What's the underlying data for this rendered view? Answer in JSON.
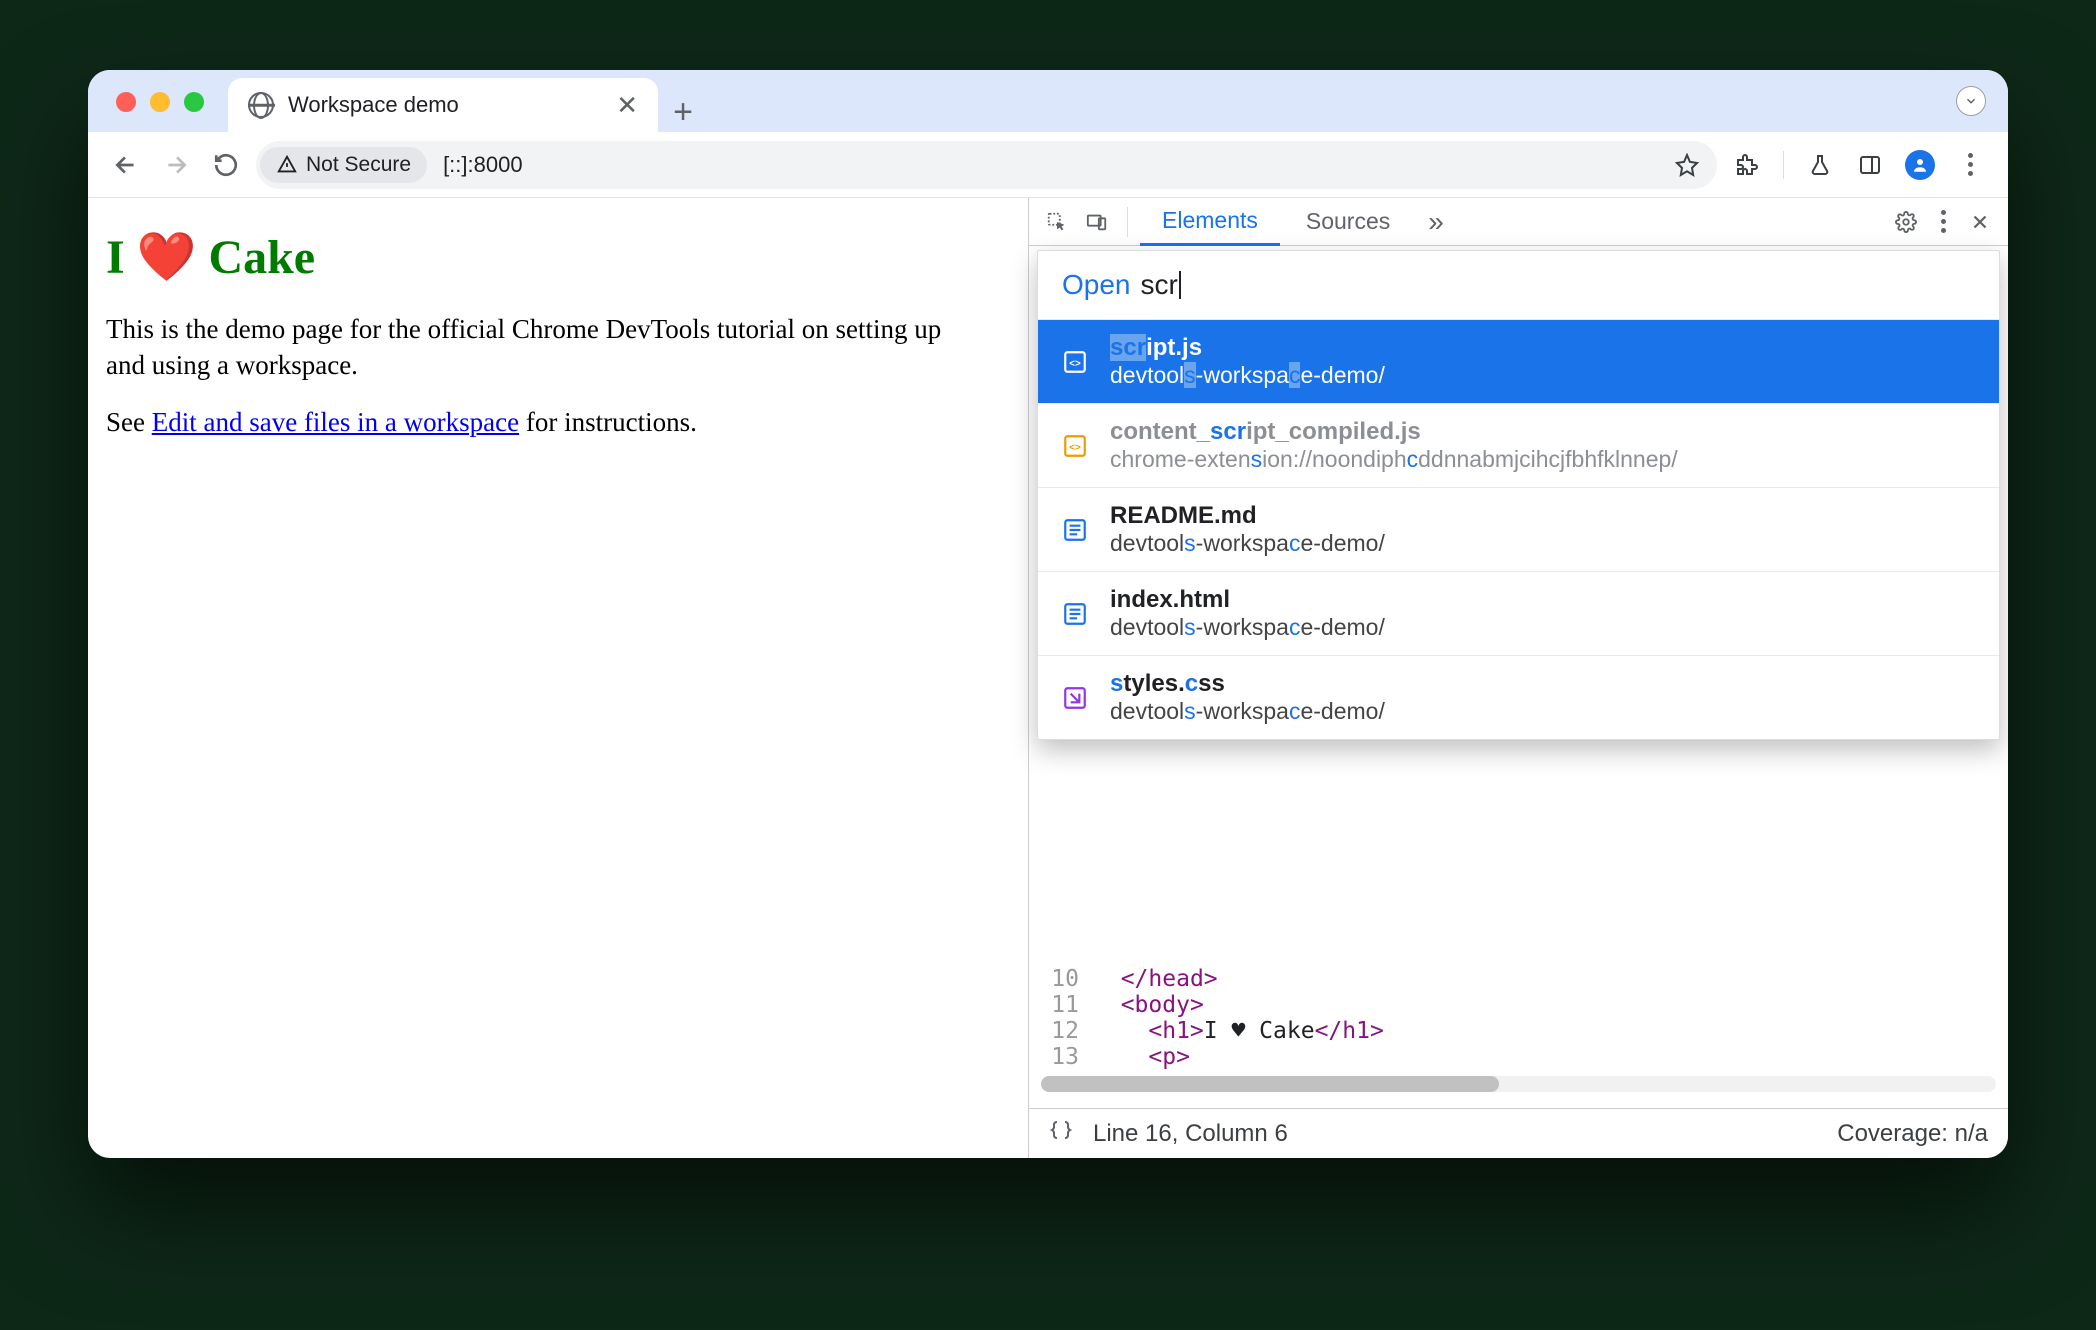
{
  "tab": {
    "title": "Workspace demo"
  },
  "toolbar": {
    "secure_label": "Not Secure",
    "url": "[::]:8000"
  },
  "page": {
    "heading": "I ❤️ Cake",
    "para1": "This is the demo page for the official Chrome DevTools tutorial on setting up and using a workspace.",
    "para2_pre": "See ",
    "para2_link": "Edit and save files in a workspace",
    "para2_post": " for instructions."
  },
  "devtools": {
    "tabs": {
      "elements": "Elements",
      "sources": "Sources",
      "more": "»"
    },
    "open": {
      "label": "Open",
      "query": "scr"
    },
    "results": [
      {
        "name": "script.js",
        "path": "devtools-workspace-demo/",
        "icon": "js",
        "selected": true
      },
      {
        "name": "content_script_compiled.js",
        "path": "chrome-extension://noondiphcddnnabmjcihcjfbhfklnnep/",
        "icon": "js-o",
        "faded": true
      },
      {
        "name": "README.md",
        "path": "devtools-workspace-demo/",
        "icon": "doc"
      },
      {
        "name": "index.html",
        "path": "devtools-workspace-demo/",
        "icon": "doc"
      },
      {
        "name": "styles.css",
        "path": "devtools-workspace-demo/",
        "icon": "css"
      }
    ],
    "code": {
      "lines": [
        {
          "n": "10",
          "html": "  </head>"
        },
        {
          "n": "11",
          "html": "  <body>"
        },
        {
          "n": "12",
          "html": "    <h1>I ♥ Cake</h1>"
        },
        {
          "n": "13",
          "html": "    <p>"
        }
      ]
    },
    "status": {
      "pos": "Line 16, Column 6",
      "coverage": "Coverage: n/a"
    }
  }
}
